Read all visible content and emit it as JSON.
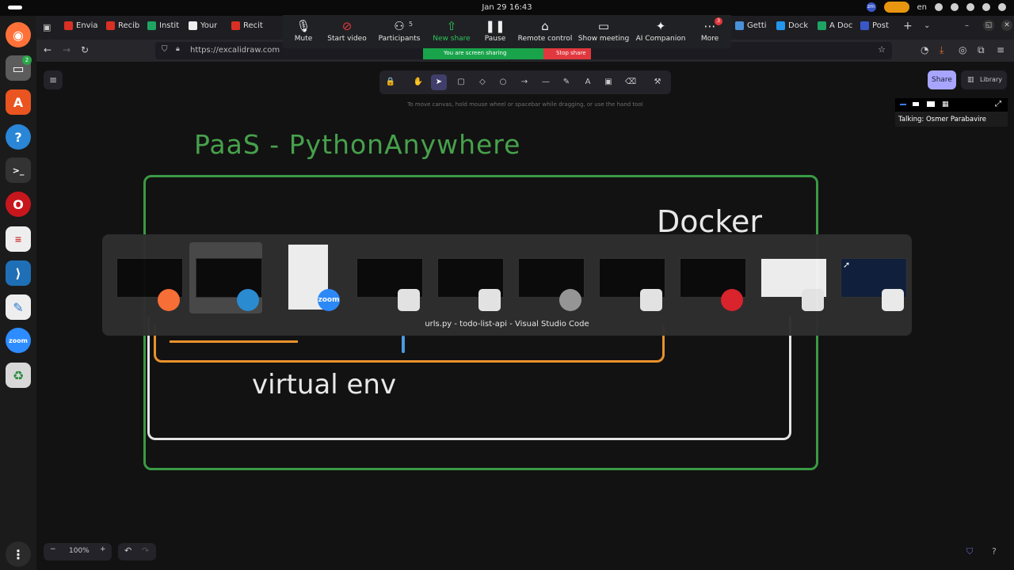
{
  "system": {
    "clock": "Jan 29 16:43",
    "lang": "en",
    "dock_badge": "2"
  },
  "browser": {
    "tabs": [
      {
        "label": "Envia",
        "icon": "gmail-icon",
        "color": "#d93025"
      },
      {
        "label": "Recib",
        "icon": "gmail-icon",
        "color": "#d93025"
      },
      {
        "label": "Instit",
        "icon": "drive-icon",
        "color": "#1fa463"
      },
      {
        "label": "Your",
        "icon": "page-icon",
        "color": "#eeeeee"
      },
      {
        "label": "Recit",
        "icon": "gmail-icon",
        "color": "#d93025"
      },
      {
        "label": "Getti",
        "icon": "page-icon",
        "color": "#4a90d9"
      },
      {
        "label": "Dock",
        "icon": "docker-icon",
        "color": "#2496ed"
      },
      {
        "label": "A Doc",
        "icon": "drive-icon",
        "color": "#1fa463"
      },
      {
        "label": "Post",
        "icon": "page-icon",
        "color": "#3957c8"
      }
    ],
    "url": "https://excalidraw.com"
  },
  "zoom": {
    "buttons": [
      {
        "label": "Mute",
        "icon": "mic-icon"
      },
      {
        "label": "Start video",
        "icon": "video-off-icon"
      },
      {
        "label": "Participants",
        "icon": "participants-icon",
        "count": "5"
      },
      {
        "label": "New share",
        "icon": "share-screen-icon"
      },
      {
        "label": "Pause",
        "icon": "pause-icon"
      },
      {
        "label": "Remote control",
        "icon": "mouse-icon"
      },
      {
        "label": "Show meeting",
        "icon": "meeting-icon"
      },
      {
        "label": "AI Companion",
        "icon": "sparkle-icon"
      },
      {
        "label": "More",
        "icon": "more-icon",
        "badge": "3"
      }
    ],
    "sharing_text": "You are screen sharing",
    "stop_share": "Stop share",
    "talking": "Talking: Osmer Parabavire"
  },
  "excalidraw": {
    "hint": "To move canvas, hold mouse wheel or spacebar while dragging, or use the hand tool",
    "share_label": "Share",
    "library_label": "Library",
    "zoom_level": "100%",
    "tools": [
      {
        "name": "lock-tool",
        "glyph": "🔒"
      },
      {
        "name": "hand-tool",
        "glyph": "✋"
      },
      {
        "name": "selection-tool",
        "glyph": "➤",
        "active": true
      },
      {
        "name": "rectangle-tool",
        "glyph": "▢"
      },
      {
        "name": "diamond-tool",
        "glyph": "◇"
      },
      {
        "name": "ellipse-tool",
        "glyph": "○"
      },
      {
        "name": "arrow-tool",
        "glyph": "→"
      },
      {
        "name": "line-tool",
        "glyph": "—"
      },
      {
        "name": "draw-tool",
        "glyph": "✎"
      },
      {
        "name": "text-tool",
        "glyph": "A"
      },
      {
        "name": "image-tool",
        "glyph": "▣"
      },
      {
        "name": "eraser-tool",
        "glyph": "⌫"
      },
      {
        "name": "more-tools",
        "glyph": "⚒"
      }
    ]
  },
  "drawing": {
    "title": "PaaS - PythonAnywhere",
    "docker": "Docker",
    "venv": "virtual env"
  },
  "switcher": {
    "caption": "urls.py - todo-list-api - Visual Studio Code",
    "windows": [
      {
        "app": "firefox",
        "icon": "firefox-icon",
        "color": "#ff7139",
        "label": ""
      },
      {
        "app": "vscode",
        "icon": "vscode-icon",
        "color": "#2b8fd8",
        "label": "",
        "selected": true
      },
      {
        "app": "zoom",
        "icon": "zoom-icon",
        "color": "#2d8cff",
        "label": "zoom"
      },
      {
        "app": "reader1",
        "icon": "reader-icon",
        "color": "#e9e9e9",
        "label": ""
      },
      {
        "app": "reader2",
        "icon": "reader-icon",
        "color": "#e9e9e9",
        "label": ""
      },
      {
        "app": "files",
        "icon": "folder-icon",
        "color": "#9a9a9a",
        "label": ""
      },
      {
        "app": "reader3",
        "icon": "reader-icon",
        "color": "#e9e9e9",
        "label": ""
      },
      {
        "app": "opera",
        "icon": "opera-icon",
        "color": "#e0242e",
        "label": ""
      },
      {
        "app": "reader4",
        "icon": "reader-icon",
        "color": "#e9e9e9",
        "label": ""
      },
      {
        "app": "editor",
        "icon": "text-editor-icon",
        "color": "#f0f0f0",
        "label": ""
      }
    ]
  }
}
